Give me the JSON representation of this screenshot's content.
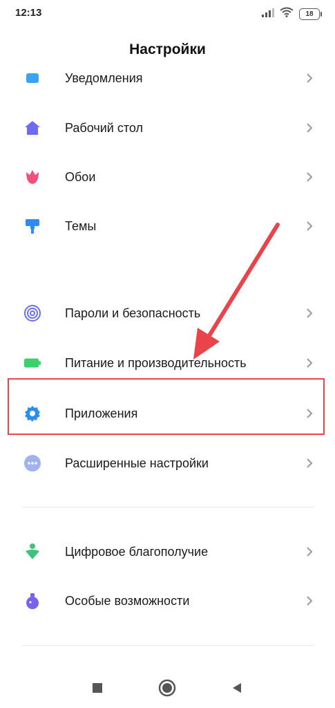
{
  "status_bar": {
    "time": "12:13",
    "battery": "18",
    "icons": [
      "signal-icon",
      "wifi-icon",
      "battery-icon"
    ]
  },
  "header": {
    "title": "Настройки"
  },
  "settings": {
    "items": [
      {
        "label": "Уведомления",
        "icon": "notifications-icon",
        "color": "#3aa3f2"
      },
      {
        "label": "Рабочий стол",
        "icon": "home-icon",
        "color": "#6e6af2"
      },
      {
        "label": "Обои",
        "icon": "tulip-icon",
        "color": "#f0507a"
      },
      {
        "label": "Темы",
        "icon": "paint-roller-icon",
        "color": "#2f8cf2"
      },
      {
        "label": "Пароли и безопасность",
        "icon": "fingerprint-icon",
        "color": "#6a6ef0"
      },
      {
        "label": "Питание и производительность",
        "icon": "battery-icon",
        "color": "#3ccf6e"
      },
      {
        "label": "Приложения",
        "icon": "gear-icon",
        "color": "#2b8ff2"
      },
      {
        "label": "Расширенные настройки",
        "icon": "more-dots-icon",
        "color": "#9fb4ee"
      },
      {
        "label": "Цифровое благополучие",
        "icon": "wellbeing-icon",
        "color": "#3fc37a"
      },
      {
        "label": "Особые возможности",
        "icon": "flask-icon",
        "color": "#7b62ec"
      }
    ]
  },
  "annotation": {
    "highlight_color": "#e8444a"
  },
  "nav_bar": {
    "buttons": [
      "recents-button",
      "home-button",
      "back-button"
    ]
  }
}
